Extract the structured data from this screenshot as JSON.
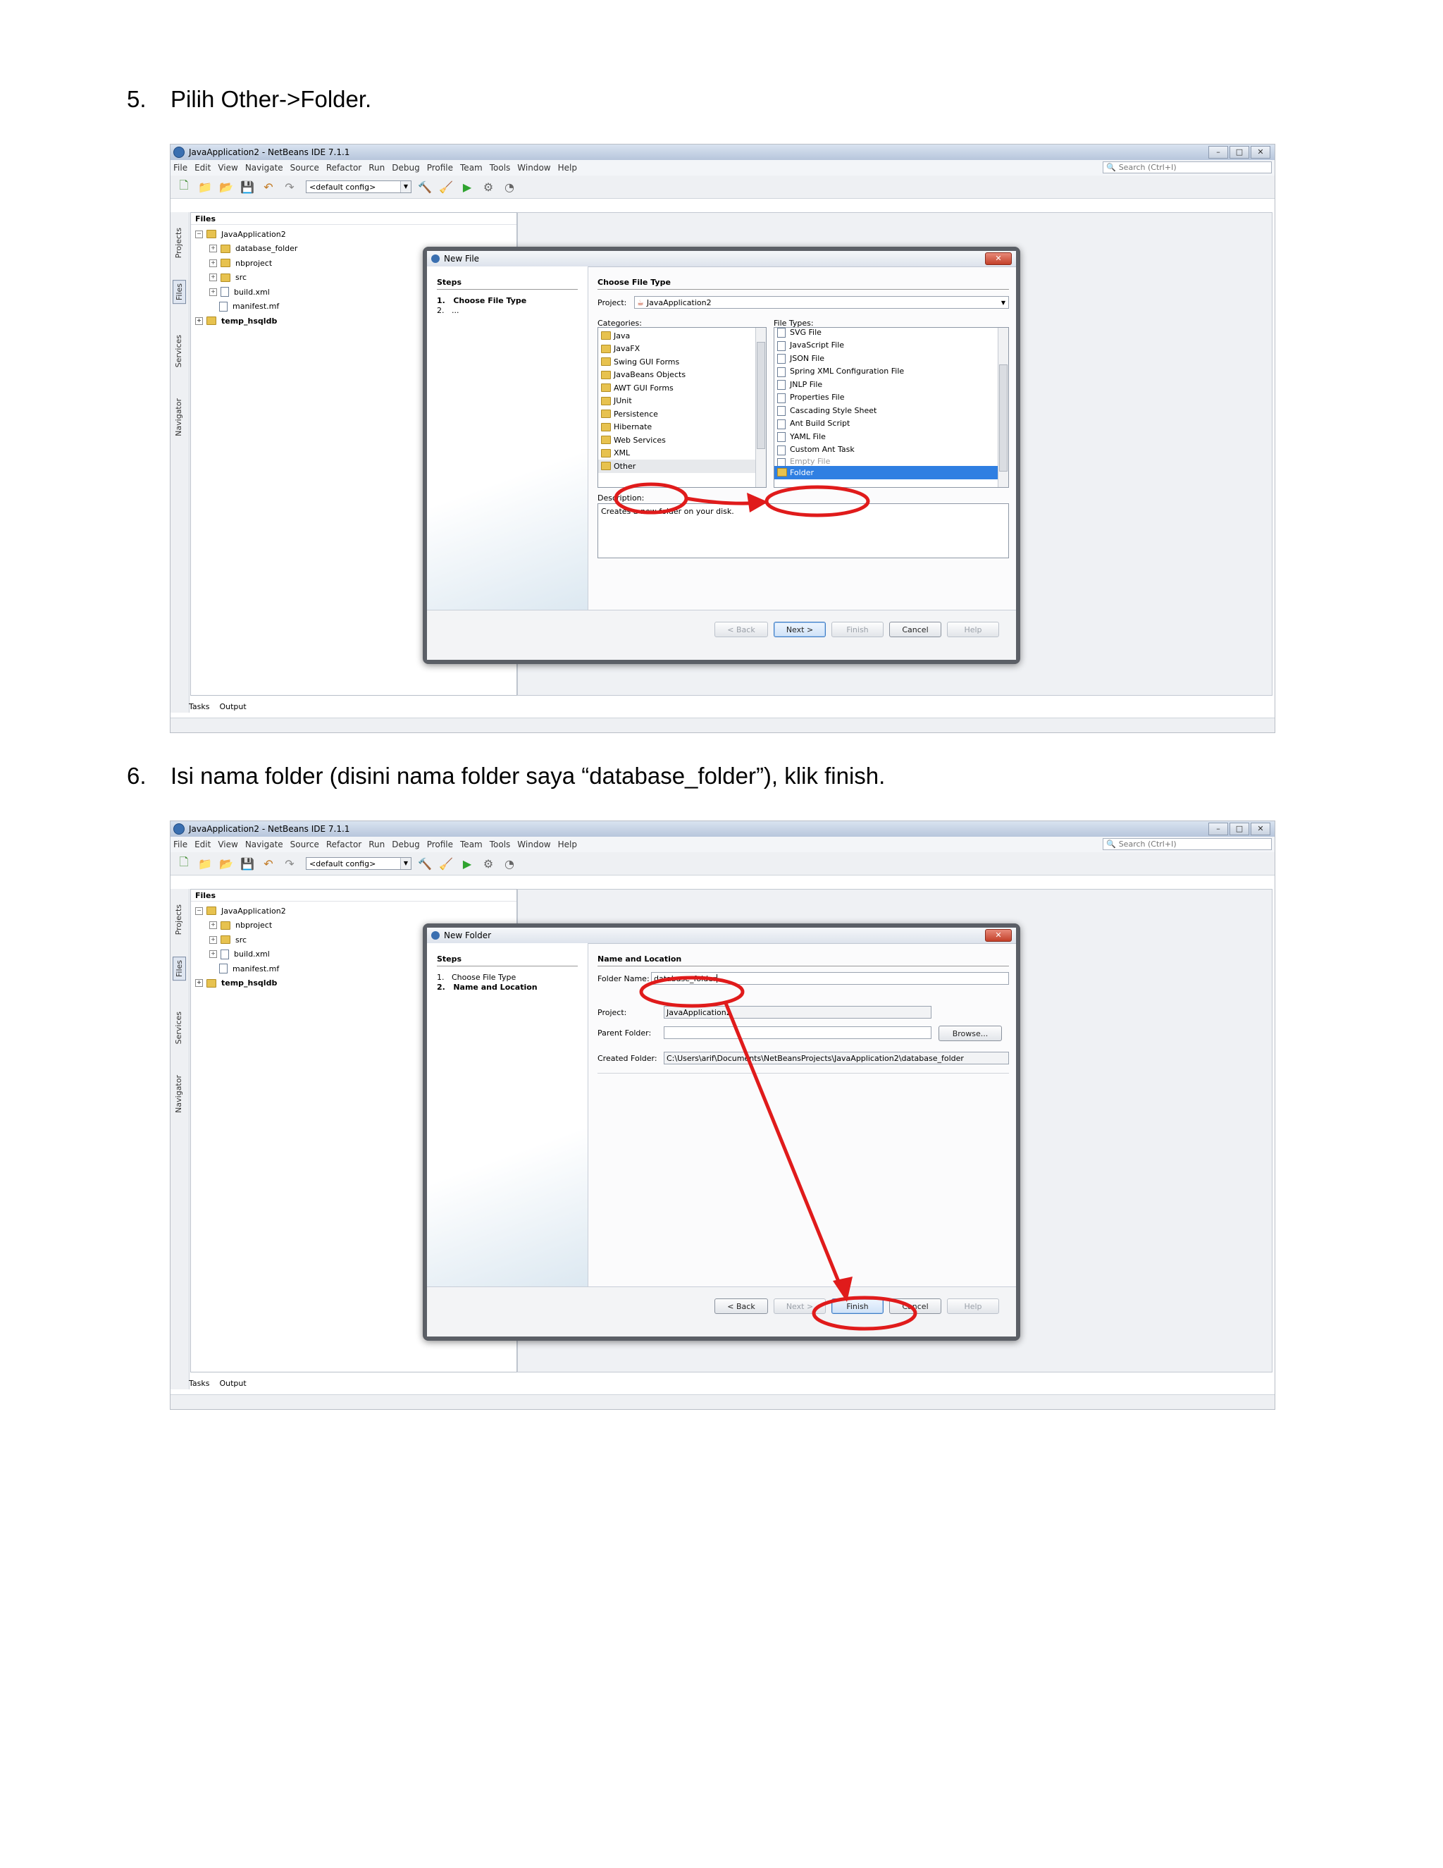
{
  "step5": {
    "number": "5.",
    "text": "Pilih Other->Folder."
  },
  "step6": {
    "number": "6.",
    "text": "Isi nama folder (disini nama folder saya  “database_folder”), klik finish."
  },
  "ide": {
    "title": "JavaApplication2 - NetBeans IDE 7.1.1",
    "menu": [
      "File",
      "Edit",
      "View",
      "Navigate",
      "Source",
      "Refactor",
      "Run",
      "Debug",
      "Profile",
      "Team",
      "Tools",
      "Window",
      "Help"
    ],
    "search_placeholder": "Search (Ctrl+I)",
    "config": "<default config>",
    "side_tabs": [
      "Projects",
      "Files",
      "Services",
      "Navigator"
    ],
    "files_panel_title": "Files",
    "bottom_tabs": [
      "Tasks",
      "Output"
    ]
  },
  "shot1": {
    "tree": [
      {
        "label": "JavaApplication2",
        "level": 0,
        "type": "project"
      },
      {
        "label": "database_folder",
        "level": 1,
        "type": "folder"
      },
      {
        "label": "nbproject",
        "level": 1,
        "type": "folder"
      },
      {
        "label": "src",
        "level": 1,
        "type": "folder"
      },
      {
        "label": "build.xml",
        "level": 1,
        "type": "xml"
      },
      {
        "label": "manifest.mf",
        "level": 1,
        "type": "file"
      },
      {
        "label": "temp_hsqldb",
        "level": 0,
        "type": "project"
      }
    ],
    "dialog": {
      "title": "New File",
      "steps_header": "Steps",
      "steps": [
        {
          "n": "1.",
          "label": "Choose File Type"
        },
        {
          "n": "2.",
          "label": "..."
        }
      ],
      "section": "Choose File Type",
      "project_label": "Project:",
      "project_value": "JavaApplication2",
      "categories_label": "Categories:",
      "categories": [
        "Java",
        "JavaFX",
        "Swing GUI Forms",
        "JavaBeans Objects",
        "AWT GUI Forms",
        "JUnit",
        "Persistence",
        "Hibernate",
        "Web Services",
        "XML",
        "Other"
      ],
      "file_types_label": "File Types:",
      "file_types": [
        "SVG File",
        "JavaScript File",
        "JSON File",
        "Spring XML Configuration File",
        "JNLP File",
        "Properties File",
        "Cascading Style Sheet",
        "Ant Build Script",
        "YAML File",
        "Custom Ant Task",
        "Empty File",
        "Folder"
      ],
      "description_label": "Description:",
      "description": "Creates a new folder on your disk.",
      "buttons": {
        "back": "< Back",
        "next": "Next >",
        "finish": "Finish",
        "cancel": "Cancel",
        "help": "Help"
      }
    }
  },
  "shot2": {
    "tree": [
      {
        "label": "JavaApplication2",
        "level": 0,
        "type": "project"
      },
      {
        "label": "nbproject",
        "level": 1,
        "type": "folder"
      },
      {
        "label": "src",
        "level": 1,
        "type": "folder"
      },
      {
        "label": "build.xml",
        "level": 1,
        "type": "xml"
      },
      {
        "label": "manifest.mf",
        "level": 1,
        "type": "file"
      },
      {
        "label": "temp_hsqldb",
        "level": 0,
        "type": "project"
      }
    ],
    "dialog": {
      "title": "New Folder",
      "steps_header": "Steps",
      "steps": [
        {
          "n": "1.",
          "label": "Choose File Type"
        },
        {
          "n": "2.",
          "label": "Name and Location"
        }
      ],
      "section": "Name and Location",
      "folder_name_label": "Folder Name:",
      "folder_name_value": "database_folder",
      "project_label": "Project:",
      "project_value": "JavaApplication2",
      "parent_folder_label": "Parent Folder:",
      "parent_folder_value": "",
      "browse": "Browse...",
      "created_folder_label": "Created Folder:",
      "created_folder_value": "C:\\Users\\arif\\Documents\\NetBeansProjects\\JavaApplication2\\database_folder",
      "buttons": {
        "back": "< Back",
        "next": "Next >",
        "finish": "Finish",
        "cancel": "Cancel",
        "help": "Help"
      }
    }
  },
  "colors": {
    "annotation_red": "#e01b1b",
    "selection_blue": "#2f7fe2",
    "folder_yellow": "#e7c24f"
  }
}
